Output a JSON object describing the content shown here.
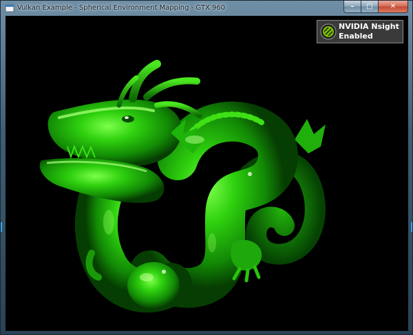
{
  "window": {
    "title": "Vulkan Example - Spherical Environment Mapping - GTX 960",
    "app_icon": "app-icon",
    "caption_buttons": {
      "minimize": {
        "icon": "minimize-icon",
        "glyph": "–"
      },
      "maximize": {
        "icon": "maximize-icon",
        "glyph": "□"
      },
      "close": {
        "icon": "close-icon",
        "glyph": "✕"
      }
    }
  },
  "overlay": {
    "line1": "NVIDIA Nsight",
    "line2": "Enabled",
    "logo": "nvidia-logo-icon"
  },
  "scene": {
    "subject": "dragon-model",
    "background_color": "#000000",
    "model_color": "#22c80a"
  },
  "colors": {
    "titlebar": "#6f8fa6",
    "frame": "#3f5d73",
    "close_button": "#c24a34",
    "overlay_background": "#3a3a3a"
  }
}
